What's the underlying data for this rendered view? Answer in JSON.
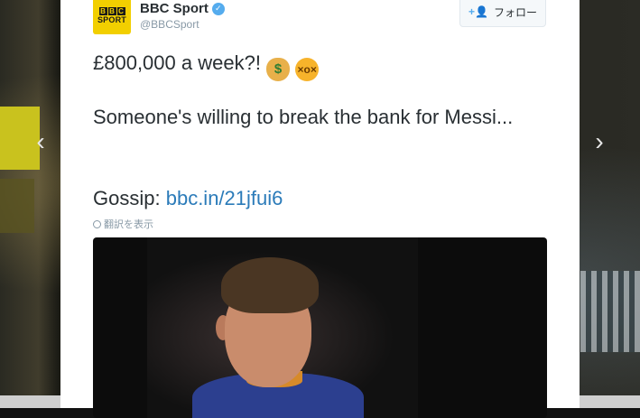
{
  "tweet": {
    "display_name": "BBC Sport",
    "handle": "@BBCSport",
    "follow_label": "フォロー",
    "avatar_letters": [
      "B",
      "B",
      "C"
    ],
    "avatar_word": "SPORT",
    "line1_text": "£800,000 a week?!",
    "line2_text": "Someone's willing to break the bank for Messi...",
    "line3_prefix": "Gossip:",
    "line3_link": "bbc.in/21jfui6",
    "translate_label": "翻訳を表示"
  },
  "navigation": {
    "prev_glyph": "‹",
    "next_glyph": "›"
  },
  "icons": {
    "verified": "verified-badge-icon",
    "follow": "add-user-icon",
    "emoji1": "money-bag-icon",
    "emoji2": "dizzy-face-icon",
    "translate": "globe-icon"
  },
  "colors": {
    "link": "#2b7bb9",
    "verified": "#55acee",
    "avatar_bg": "#f2cf00",
    "text": "#292f33",
    "muted": "#8899a6"
  }
}
